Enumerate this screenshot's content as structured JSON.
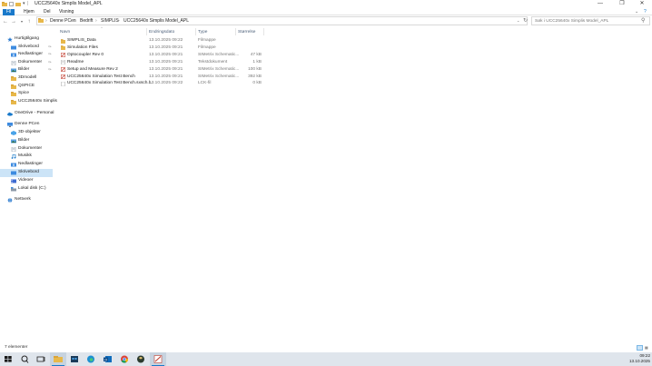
{
  "window": {
    "title": "UCC25640x Simplis Model_APL",
    "controls": [
      "minimize",
      "maximize",
      "close"
    ]
  },
  "ribbon": {
    "tabs": [
      "Fil",
      "Hjem",
      "Del",
      "Visning"
    ]
  },
  "address": {
    "crumbs": [
      "Denne PCen",
      "Bedrift",
      "SIMPLIS",
      "UCC25640x Simplis Model_APL"
    ]
  },
  "search": {
    "placeholder": "Søk i UCC25640x Simplis Model_APL"
  },
  "nav": {
    "items": [
      {
        "label": "Hurtigtilgang",
        "icon": "star-icon",
        "pinned": false,
        "selected": false,
        "level": 0
      },
      {
        "label": "Skrivebord",
        "icon": "desktop-folder-icon",
        "pinned": true,
        "selected": false,
        "level": 1
      },
      {
        "label": "Nedlastinger",
        "icon": "download-folder-icon",
        "pinned": true,
        "selected": false,
        "level": 1
      },
      {
        "label": "Dokumenter",
        "icon": "documents-folder-icon",
        "pinned": true,
        "selected": false,
        "level": 1
      },
      {
        "label": "Bilder",
        "icon": "pictures-folder-icon",
        "pinned": true,
        "selected": false,
        "level": 1
      },
      {
        "label": "3Dmodell",
        "icon": "folder-icon",
        "pinned": false,
        "selected": false,
        "level": 1
      },
      {
        "label": "QSPICE",
        "icon": "folder-icon",
        "pinned": false,
        "selected": false,
        "level": 1
      },
      {
        "label": "Spice",
        "icon": "folder-icon",
        "pinned": false,
        "selected": false,
        "level": 1
      },
      {
        "label": "UCC25640x Simplis",
        "icon": "folder-icon",
        "pinned": false,
        "selected": false,
        "level": 1
      },
      {
        "label": "OneDrive - Personal",
        "icon": "cloud-icon",
        "pinned": false,
        "selected": false,
        "level": 0
      },
      {
        "label": "Denne PCen",
        "icon": "computer-icon",
        "pinned": false,
        "selected": false,
        "level": 0
      },
      {
        "label": "3D-objekter",
        "icon": "3d-objects-icon",
        "pinned": false,
        "selected": false,
        "level": 1
      },
      {
        "label": "Bilder",
        "icon": "pictures-folder-icon",
        "pinned": false,
        "selected": false,
        "level": 1
      },
      {
        "label": "Dokumenter",
        "icon": "documents-folder-icon",
        "pinned": false,
        "selected": false,
        "level": 1
      },
      {
        "label": "Musikk",
        "icon": "music-folder-icon",
        "pinned": false,
        "selected": false,
        "level": 1
      },
      {
        "label": "Nedlastinger",
        "icon": "download-folder-icon",
        "pinned": false,
        "selected": false,
        "level": 1
      },
      {
        "label": "Skrivebord",
        "icon": "desktop-folder-icon",
        "pinned": false,
        "selected": true,
        "level": 1
      },
      {
        "label": "Videoer",
        "icon": "videos-folder-icon",
        "pinned": false,
        "selected": false,
        "level": 1
      },
      {
        "label": "Lokal disk (C:)",
        "icon": "drive-icon",
        "pinned": false,
        "selected": false,
        "level": 1
      },
      {
        "label": "Nettverk",
        "icon": "network-icon",
        "pinned": false,
        "selected": false,
        "level": 0
      }
    ]
  },
  "columns": {
    "name": "Navn",
    "date": "Endringsdato",
    "type": "Type",
    "size": "Størrelse"
  },
  "files": [
    {
      "name": "SIMPLIS_Data",
      "date": "13.10.2025 09:22",
      "type": "Filmappe",
      "size": "",
      "icon": "folder-icon"
    },
    {
      "name": "Simulation Files",
      "date": "13.10.2025 09:21",
      "type": "Filmappe",
      "size": "",
      "icon": "folder-icon"
    },
    {
      "name": "Optocoupler Rev 0",
      "date": "13.10.2025 09:21",
      "type": "SIMetrix Schematic...",
      "size": "47 kB",
      "icon": "schematic-icon"
    },
    {
      "name": "Readme",
      "date": "13.10.2025 09:21",
      "type": "Tekstdokument",
      "size": "1 kB",
      "icon": "text-file-icon"
    },
    {
      "name": "Setup and Measure Rev 2",
      "date": "13.10.2025 09:21",
      "type": "SIMetrix Schematic...",
      "size": "100 kB",
      "icon": "schematic-icon"
    },
    {
      "name": "UCC25640x Simulation Test Bench",
      "date": "13.10.2025 09:21",
      "type": "SIMetrix Schematic...",
      "size": "392 kB",
      "icon": "schematic-icon"
    },
    {
      "name": "UCC25640x Simulation Test Bench.sxsch.l...",
      "date": "13.10.2025 09:22",
      "type": "LCK-fil",
      "size": "0 kB",
      "icon": "generic-file-icon"
    }
  ],
  "status": {
    "item_count": "7 elementer"
  },
  "taskbar": {
    "time": "09:22",
    "date": "13.10.2025"
  },
  "colors": {
    "accent": "#1979ca",
    "selection": "#cce4f7",
    "folder": "#e8b84a"
  }
}
